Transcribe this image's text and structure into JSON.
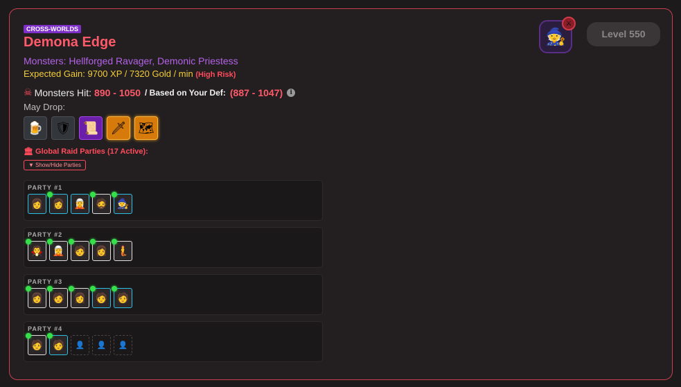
{
  "raid": {
    "tag": "CROSS-WORLDS",
    "title": "Demona Edge",
    "monsters": "Monsters: Hellforged Ravager, Demonic Priestess",
    "gain": "Expected Gain: 9700 XP / 7320 Gold / min",
    "risk": "(High Risk)",
    "hit_label": "Monsters Hit:",
    "hit_range": "890 - 1050",
    "def_label": "/ Based on Your Def:",
    "def_range": "(887 - 1047)",
    "info_icon": "i",
    "may_drop": "May Drop:",
    "level": "Level 550",
    "raid_parties": "Global Raid Parties (17 Active):",
    "toggle": "▼ Show/Hide Parties"
  },
  "drops": [
    {
      "icon": "🍺",
      "rarity": "common"
    },
    {
      "icon": "🛡",
      "rarity": "common"
    },
    {
      "icon": "📜",
      "rarity": "epic"
    },
    {
      "icon": "🗡",
      "rarity": "legend"
    },
    {
      "icon": "🗺",
      "rarity": "legend"
    }
  ],
  "parties": [
    {
      "label": "PARTY #1"
    },
    {
      "label": "PARTY #2"
    },
    {
      "label": "PARTY #3"
    },
    {
      "label": "PARTY #4"
    }
  ],
  "colors": {
    "accent": "#ff5a6a",
    "online": "#35e04a",
    "epic": "#6a1fa8",
    "legendary": "#d67a0b"
  }
}
